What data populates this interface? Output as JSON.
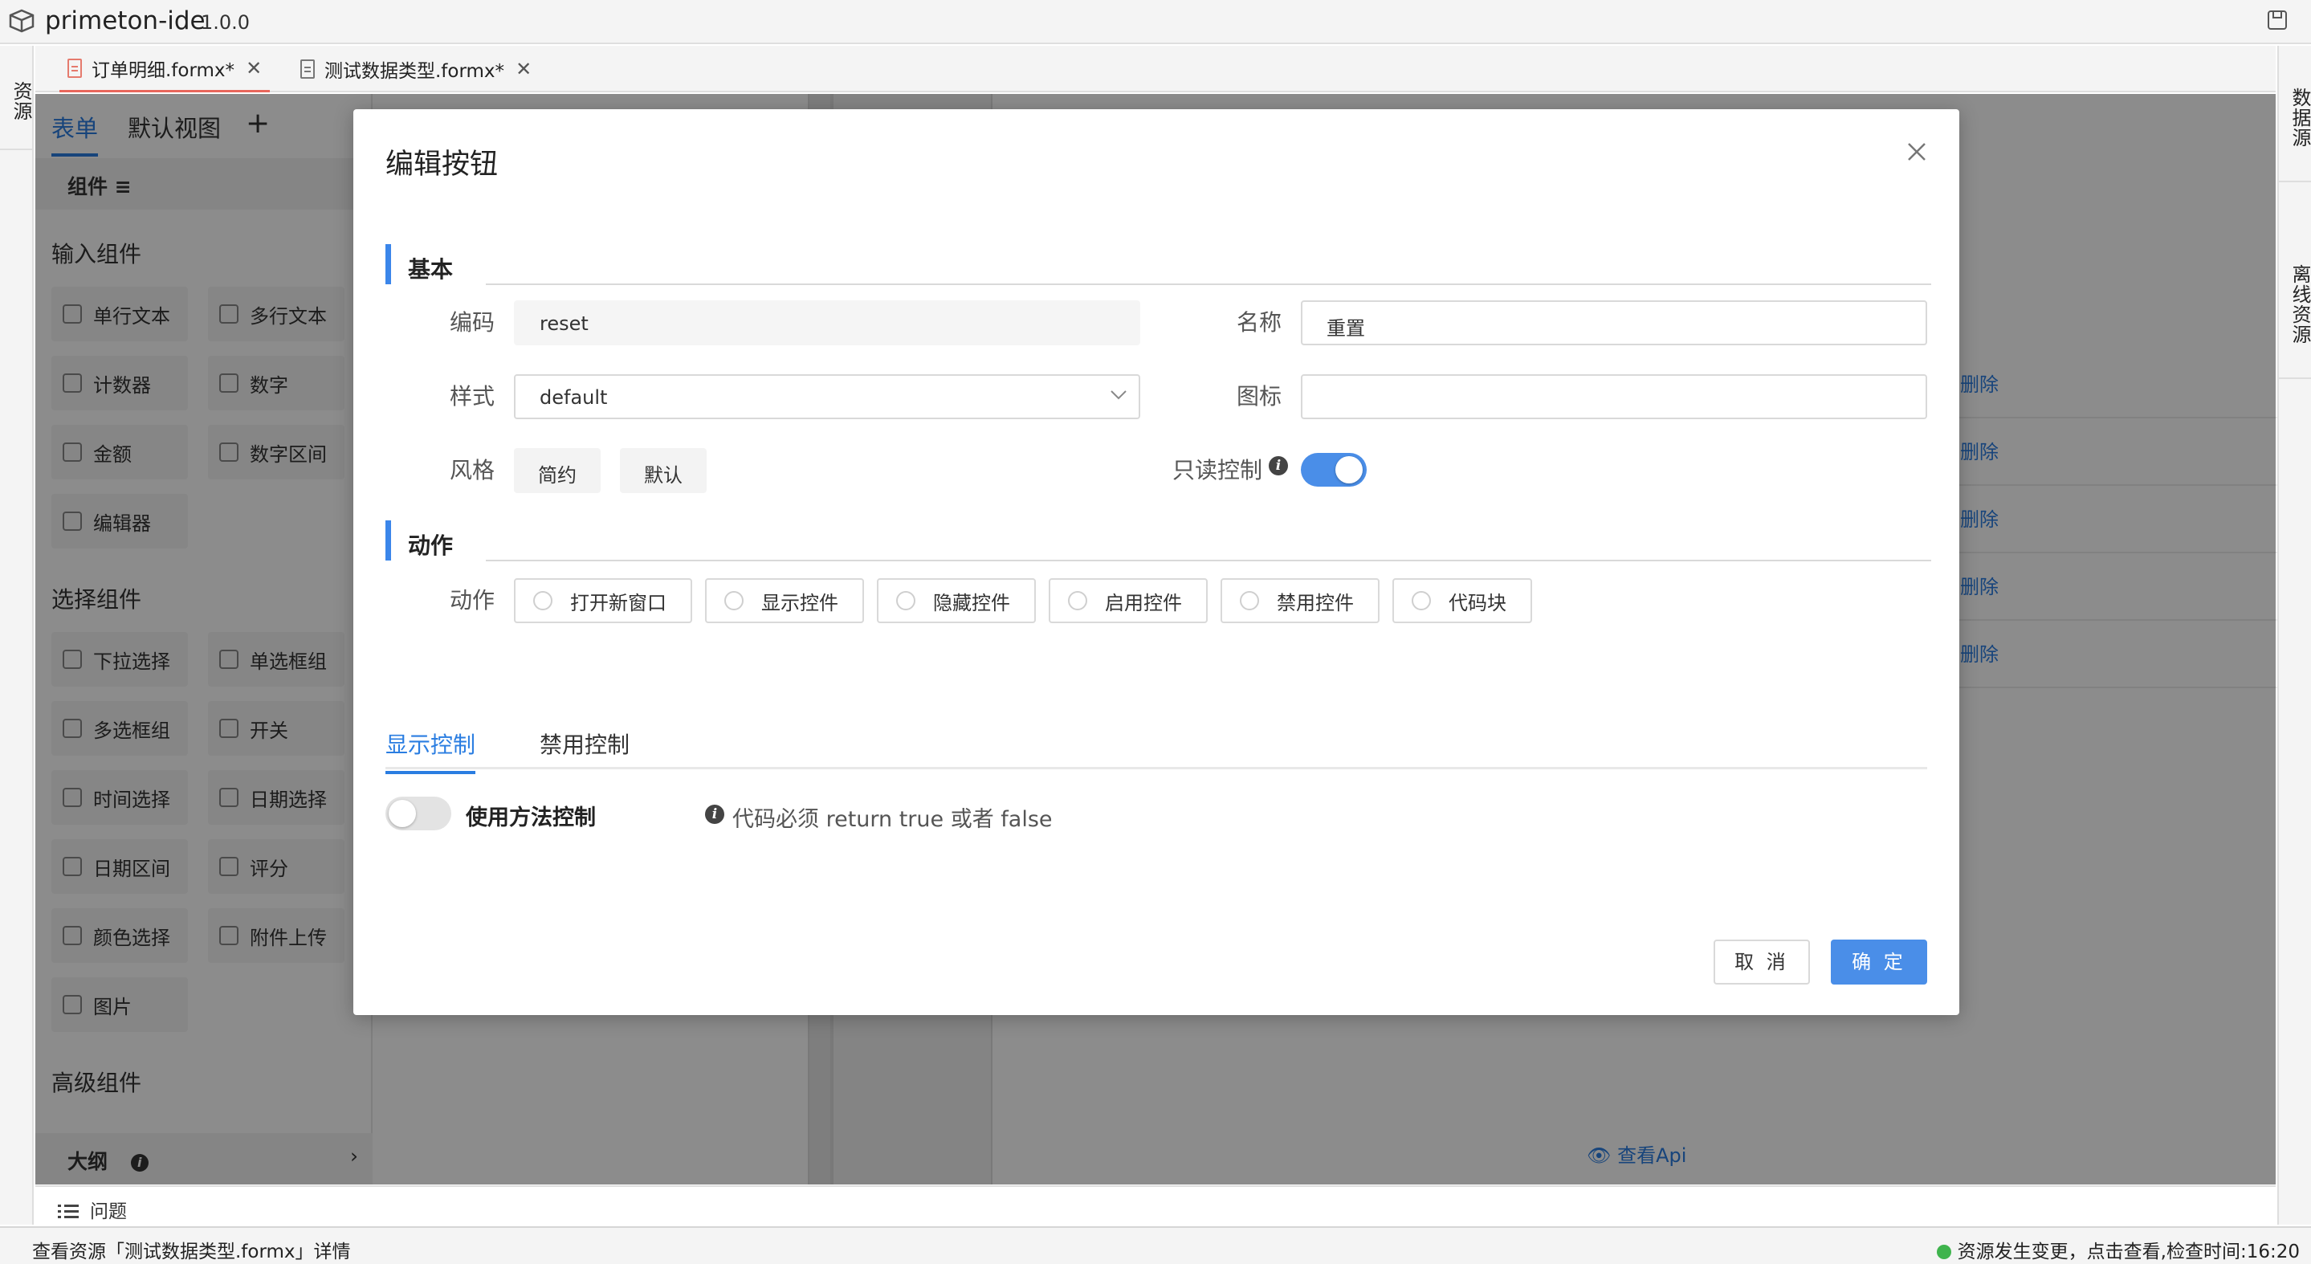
{
  "app": {
    "name": "primeton-ide",
    "version": "1.0.0"
  },
  "left_strip": {
    "resources": "资源"
  },
  "right_strip": {
    "datasource": "数据源",
    "offline": "离线资源"
  },
  "file_tabs": [
    {
      "label": "订单明细.formx*",
      "active": true
    },
    {
      "label": "测试数据类型.formx*",
      "active": false
    }
  ],
  "left_panel": {
    "view_tabs": [
      "表单",
      "默认视图"
    ],
    "add_label": "+",
    "components_header": "组件 ≡",
    "groups": [
      {
        "title": "输入组件",
        "items": [
          "单行文本",
          "多行文本",
          "计数器",
          "数字",
          "金额",
          "数字区间",
          "编辑器"
        ]
      },
      {
        "title": "选择组件",
        "items": [
          "下拉选择",
          "单选框组",
          "多选框组",
          "开关",
          "时间选择",
          "日期选择",
          "日期区间",
          "评分",
          "颜色选择",
          "附件上传",
          "图片"
        ]
      },
      {
        "title": "高级组件",
        "items": []
      }
    ],
    "outline": "大纲"
  },
  "canvas": {
    "delete_label": "删除",
    "row_count": 5,
    "view_api": "查看Api"
  },
  "problems": "问题",
  "status": {
    "left": "查看资源「测试数据类型.formx」详情",
    "right": "资源发生变更，点击查看,检查时间:16:20",
    "dot_color": "#3fb44d"
  },
  "modal": {
    "title": "编辑按钮",
    "section_basic": "基本",
    "code_label": "编码",
    "code_value": "reset",
    "name_label": "名称",
    "name_value": "重置",
    "style_label": "样式",
    "style_value": "default",
    "icon_label": "图标",
    "icon_value": "",
    "theme_label": "风格",
    "theme_options": [
      "简约",
      "默认"
    ],
    "readonly_label": "只读控制",
    "readonly_on": true,
    "section_action": "动作",
    "action_label": "动作",
    "actions": [
      "打开新窗口",
      "显示控件",
      "隐藏控件",
      "启用控件",
      "禁用控件",
      "代码块"
    ],
    "sub_tabs": [
      "显示控制",
      "禁用控制"
    ],
    "method_toggle_label": "使用方法控制",
    "method_toggle_on": false,
    "hint": "代码必须 return true 或者 false",
    "cancel": "取 消",
    "ok": "确 定"
  },
  "colors": {
    "primary": "#4a8ee8",
    "tab_active": "#e8675c"
  }
}
